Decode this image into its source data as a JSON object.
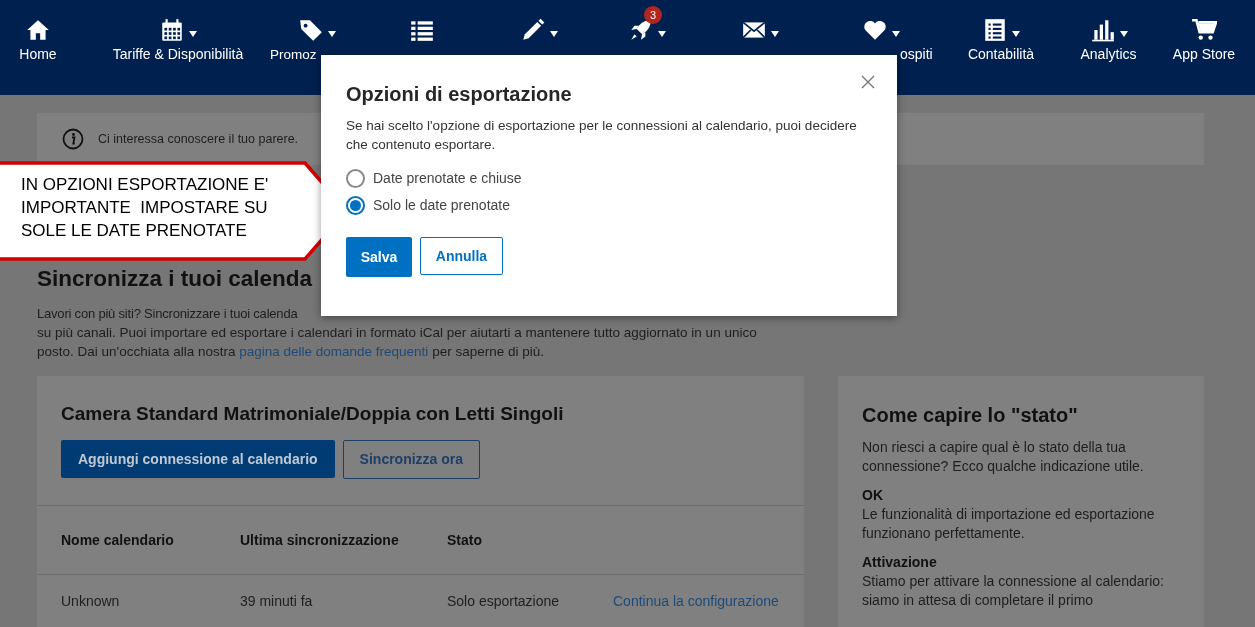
{
  "nav": [
    {
      "label": "Home",
      "caret": false
    },
    {
      "label": "Tariffe & Disponibilità",
      "caret": true
    },
    {
      "label": "Promoz",
      "caret": true
    },
    {
      "caret": false
    },
    {
      "caret": true
    },
    {
      "caret": true,
      "badge": "3"
    },
    {
      "caret": true
    },
    {
      "label": "ospiti",
      "caret": true
    },
    {
      "label": "Contabilità",
      "caret": true
    },
    {
      "label": "Analytics",
      "caret": true
    },
    {
      "label": "App Store",
      "caret": false
    }
  ],
  "banner": {
    "text": "Ci interessa conoscere il tuo parere."
  },
  "heading": "Sincronizza i tuoi calenda",
  "intro": {
    "line_1": "Lavori con più siti? Sincronizzare i tuoi calenda",
    "line_2": "su più canali. Puoi importare ed esportare i calendari in formato iCal per aiutarti a mantenere tutto aggiornato in un unico",
    "line_3_before": "posto. Dai un'occhiata alla nostra",
    "link": "pagina delle domande frequenti",
    "line_3_after": "per saperne di più."
  },
  "room_card": {
    "title": "Camera Standard Matrimoniale/Doppia con Letti Singoli",
    "buttons": [
      "Aggiungi connessione al calendario",
      "Sincronizza ora"
    ],
    "table": {
      "columns": [
        "Nome calendario",
        "Ultima sincronizzazione",
        "Stato"
      ],
      "rows": [
        {
          "name": "Unknown",
          "last_sync": "39 minuti fa",
          "status": "Solo esportazione",
          "action": "Continua la configurazione"
        }
      ]
    }
  },
  "status_card": {
    "title": "Come capire lo \"stato\"",
    "intro": "Non riesci a capire qual è lo stato della tua connessione? Ecco qualche indicazione utile.",
    "items": [
      {
        "term": "OK",
        "text": "Le funzionalità di importazione ed esportazione funzionano perfettamente."
      },
      {
        "term": "Attivazione",
        "text": "Stiamo per attivare la connessione al calendario: siamo in attesa di completare il primo"
      }
    ]
  },
  "modal": {
    "title": "Opzioni di esportazione",
    "text": "Se hai scelto l'opzione di esportazione per le connessioni al calendario, puoi decidere che contenuto esportare.",
    "options": [
      {
        "label": "Date prenotate e chiuse",
        "selected": false
      },
      {
        "label": "Solo le date prenotate",
        "selected": true
      }
    ],
    "save": "Salva",
    "cancel": "Annulla"
  },
  "callout": {
    "text": "IN OPZIONI ESPORTAZIONE E' IMPORTANTE  IMPOSTARE SU SOLE LE DATE PRENOTATE"
  }
}
